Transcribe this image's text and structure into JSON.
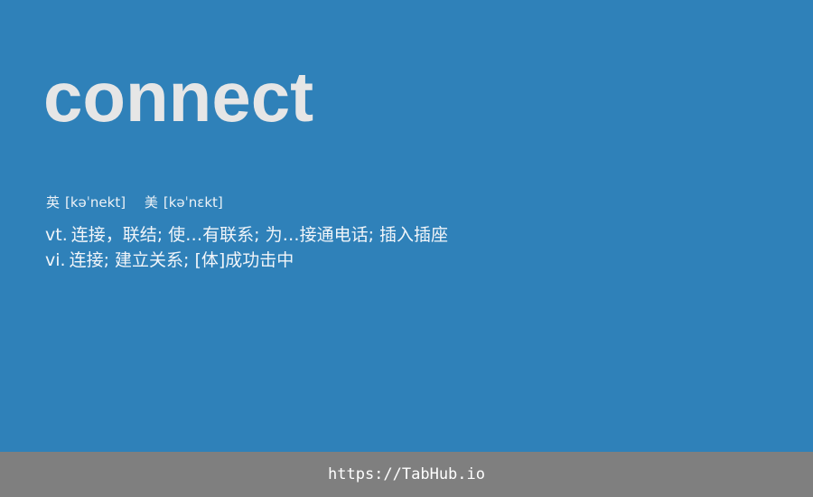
{
  "entry": {
    "word": "connect",
    "phonetics": [
      {
        "label": "英",
        "ipa": "[kəˈnekt]"
      },
      {
        "label": "美",
        "ipa": "[kəˈnɛkt]"
      }
    ],
    "definitions": [
      {
        "pos": "vt.",
        "text": "连接，联结; 使…有联系; 为…接通电话; 插入插座"
      },
      {
        "pos": "vi.",
        "text": "连接; 建立关系; [体]成功击中"
      }
    ]
  },
  "footer": {
    "link": "https://TabHub.io"
  },
  "colors": {
    "background": "#2f81b9",
    "footer_background": "#7f7f7f",
    "word_color": "#e6e6e6"
  }
}
